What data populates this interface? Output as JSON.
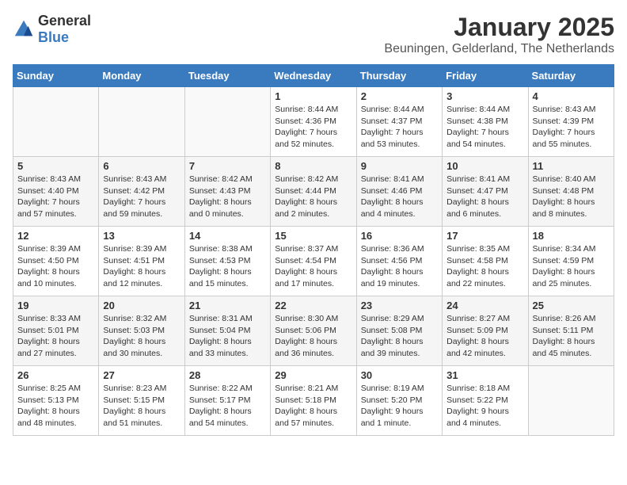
{
  "logo": {
    "general": "General",
    "blue": "Blue"
  },
  "header": {
    "month": "January 2025",
    "location": "Beuningen, Gelderland, The Netherlands"
  },
  "days_of_week": [
    "Sunday",
    "Monday",
    "Tuesday",
    "Wednesday",
    "Thursday",
    "Friday",
    "Saturday"
  ],
  "weeks": [
    [
      {
        "day": "",
        "info": ""
      },
      {
        "day": "",
        "info": ""
      },
      {
        "day": "",
        "info": ""
      },
      {
        "day": "1",
        "info": "Sunrise: 8:44 AM\nSunset: 4:36 PM\nDaylight: 7 hours and 52 minutes."
      },
      {
        "day": "2",
        "info": "Sunrise: 8:44 AM\nSunset: 4:37 PM\nDaylight: 7 hours and 53 minutes."
      },
      {
        "day": "3",
        "info": "Sunrise: 8:44 AM\nSunset: 4:38 PM\nDaylight: 7 hours and 54 minutes."
      },
      {
        "day": "4",
        "info": "Sunrise: 8:43 AM\nSunset: 4:39 PM\nDaylight: 7 hours and 55 minutes."
      }
    ],
    [
      {
        "day": "5",
        "info": "Sunrise: 8:43 AM\nSunset: 4:40 PM\nDaylight: 7 hours and 57 minutes."
      },
      {
        "day": "6",
        "info": "Sunrise: 8:43 AM\nSunset: 4:42 PM\nDaylight: 7 hours and 59 minutes."
      },
      {
        "day": "7",
        "info": "Sunrise: 8:42 AM\nSunset: 4:43 PM\nDaylight: 8 hours and 0 minutes."
      },
      {
        "day": "8",
        "info": "Sunrise: 8:42 AM\nSunset: 4:44 PM\nDaylight: 8 hours and 2 minutes."
      },
      {
        "day": "9",
        "info": "Sunrise: 8:41 AM\nSunset: 4:46 PM\nDaylight: 8 hours and 4 minutes."
      },
      {
        "day": "10",
        "info": "Sunrise: 8:41 AM\nSunset: 4:47 PM\nDaylight: 8 hours and 6 minutes."
      },
      {
        "day": "11",
        "info": "Sunrise: 8:40 AM\nSunset: 4:48 PM\nDaylight: 8 hours and 8 minutes."
      }
    ],
    [
      {
        "day": "12",
        "info": "Sunrise: 8:39 AM\nSunset: 4:50 PM\nDaylight: 8 hours and 10 minutes."
      },
      {
        "day": "13",
        "info": "Sunrise: 8:39 AM\nSunset: 4:51 PM\nDaylight: 8 hours and 12 minutes."
      },
      {
        "day": "14",
        "info": "Sunrise: 8:38 AM\nSunset: 4:53 PM\nDaylight: 8 hours and 15 minutes."
      },
      {
        "day": "15",
        "info": "Sunrise: 8:37 AM\nSunset: 4:54 PM\nDaylight: 8 hours and 17 minutes."
      },
      {
        "day": "16",
        "info": "Sunrise: 8:36 AM\nSunset: 4:56 PM\nDaylight: 8 hours and 19 minutes."
      },
      {
        "day": "17",
        "info": "Sunrise: 8:35 AM\nSunset: 4:58 PM\nDaylight: 8 hours and 22 minutes."
      },
      {
        "day": "18",
        "info": "Sunrise: 8:34 AM\nSunset: 4:59 PM\nDaylight: 8 hours and 25 minutes."
      }
    ],
    [
      {
        "day": "19",
        "info": "Sunrise: 8:33 AM\nSunset: 5:01 PM\nDaylight: 8 hours and 27 minutes."
      },
      {
        "day": "20",
        "info": "Sunrise: 8:32 AM\nSunset: 5:03 PM\nDaylight: 8 hours and 30 minutes."
      },
      {
        "day": "21",
        "info": "Sunrise: 8:31 AM\nSunset: 5:04 PM\nDaylight: 8 hours and 33 minutes."
      },
      {
        "day": "22",
        "info": "Sunrise: 8:30 AM\nSunset: 5:06 PM\nDaylight: 8 hours and 36 minutes."
      },
      {
        "day": "23",
        "info": "Sunrise: 8:29 AM\nSunset: 5:08 PM\nDaylight: 8 hours and 39 minutes."
      },
      {
        "day": "24",
        "info": "Sunrise: 8:27 AM\nSunset: 5:09 PM\nDaylight: 8 hours and 42 minutes."
      },
      {
        "day": "25",
        "info": "Sunrise: 8:26 AM\nSunset: 5:11 PM\nDaylight: 8 hours and 45 minutes."
      }
    ],
    [
      {
        "day": "26",
        "info": "Sunrise: 8:25 AM\nSunset: 5:13 PM\nDaylight: 8 hours and 48 minutes."
      },
      {
        "day": "27",
        "info": "Sunrise: 8:23 AM\nSunset: 5:15 PM\nDaylight: 8 hours and 51 minutes."
      },
      {
        "day": "28",
        "info": "Sunrise: 8:22 AM\nSunset: 5:17 PM\nDaylight: 8 hours and 54 minutes."
      },
      {
        "day": "29",
        "info": "Sunrise: 8:21 AM\nSunset: 5:18 PM\nDaylight: 8 hours and 57 minutes."
      },
      {
        "day": "30",
        "info": "Sunrise: 8:19 AM\nSunset: 5:20 PM\nDaylight: 9 hours and 1 minute."
      },
      {
        "day": "31",
        "info": "Sunrise: 8:18 AM\nSunset: 5:22 PM\nDaylight: 9 hours and 4 minutes."
      },
      {
        "day": "",
        "info": ""
      }
    ]
  ]
}
